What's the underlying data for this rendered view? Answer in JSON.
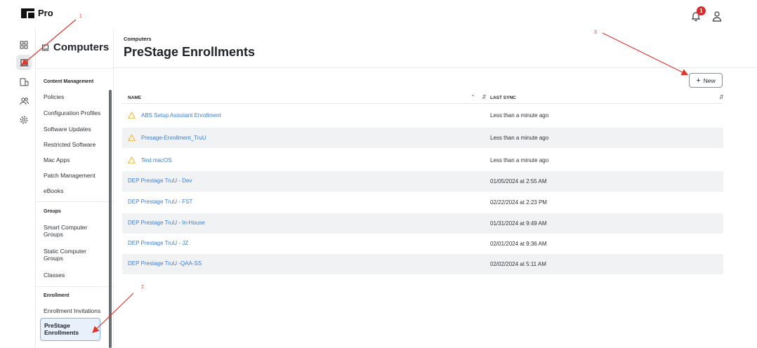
{
  "app": {
    "logo_text": "Pro"
  },
  "header": {
    "notification_count": "1"
  },
  "rail": {
    "icons": [
      "dashboard-icon",
      "computer-icon",
      "devices-icon",
      "users-icon",
      "settings-icon"
    ]
  },
  "sidebar": {
    "title": "Computers",
    "sections": [
      {
        "label": "Content Management",
        "items": [
          "Policies",
          "Configuration Profiles",
          "Software Updates",
          "Restricted Software",
          "Mac Apps",
          "Patch Management",
          "eBooks"
        ]
      },
      {
        "label": "Groups",
        "items": [
          "Smart Computer Groups",
          "Static Computer Groups",
          "Classes"
        ]
      },
      {
        "label": "Enrollment",
        "items": [
          "Enrollment Invitations",
          "PreStage Enrollments"
        ]
      }
    ]
  },
  "main": {
    "breadcrumb": "Computers",
    "title": "PreStage Enrollments",
    "new_button": "New",
    "columns": {
      "name": "NAME",
      "last_sync": "LAST SYNC"
    },
    "rows": [
      {
        "name": "ABS Setup Asisstant Enrollment",
        "last_sync": "Less than a minute ago",
        "warning": true
      },
      {
        "name": "Presage-Enrollment_TruU",
        "last_sync": "Less than a minute ago",
        "warning": true
      },
      {
        "name": "Test macOS",
        "last_sync": "Less than a minute ago",
        "warning": true
      },
      {
        "name": "DEP Prestage TruU - Dev",
        "last_sync": "01/05/2024 at 2:55 AM",
        "warning": false
      },
      {
        "name": "DEP Prestage TruU - FST",
        "last_sync": "02/22/2024 at 2:23 PM",
        "warning": false
      },
      {
        "name": "DEP Prestage TruU - In-House",
        "last_sync": "01/31/2024 at 9:49 AM",
        "warning": false
      },
      {
        "name": "DEP Prestage TruU - JZ",
        "last_sync": "02/01/2024 at 9:36 AM",
        "warning": false
      },
      {
        "name": "DEP Prestage TruU -QAA-SS",
        "last_sync": "02/02/2024 at 5:11 AM",
        "warning": false
      }
    ]
  },
  "annotations": [
    "1",
    "2",
    "3"
  ],
  "colors": {
    "link": "#3b7dd8",
    "warning": "#f0b429",
    "annotation": "#e0362c",
    "selected_border": "#7fb4f0"
  }
}
